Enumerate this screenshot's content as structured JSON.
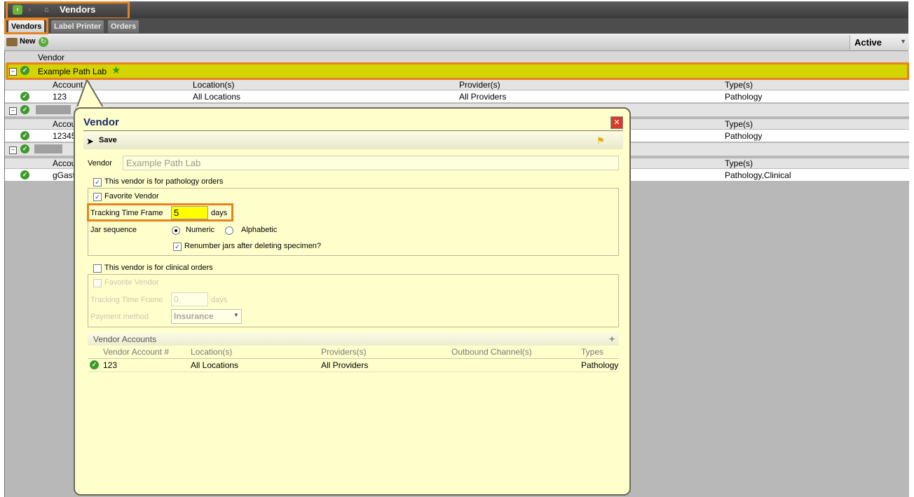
{
  "window": {
    "title": "Vendors"
  },
  "tabs": [
    {
      "label": "Vendors"
    },
    {
      "label": "Label Printer"
    },
    {
      "label": "Orders"
    }
  ],
  "toolbar": {
    "new_label": "New",
    "filter_value": "Active"
  },
  "grid": {
    "column_header": "Vendor",
    "sub_headers": {
      "account": "Account #",
      "location": "Location(s)",
      "provider": "Provider(s)",
      "types": "Type(s)"
    },
    "vendors": [
      {
        "name": "Example Path Lab",
        "account": "123",
        "location": "All Locations",
        "provider": "All Providers",
        "types": "Pathology",
        "favorite": true
      },
      {
        "name": "",
        "account": "12345",
        "types": "Pathology"
      },
      {
        "name": "",
        "account": "gGast",
        "types": "Pathology,Clinical"
      }
    ],
    "trunc_account": "Accou"
  },
  "popup": {
    "title": "Vendor",
    "save_label": "Save",
    "vendor_label": "Vendor",
    "vendor_value": "Example Path Lab",
    "pathology": {
      "checkbox_label": "This vendor is for pathology orders",
      "checked": true,
      "favorite_label": "Favorite Vendor",
      "tracking_label": "Tracking Time Frame",
      "tracking_value": "5",
      "tracking_units": "days",
      "jar_label": "Jar sequence",
      "jar_options": [
        "Numeric",
        "Alphabetic"
      ],
      "jar_selected": "Numeric",
      "renumber_label": "Renumber jars after deleting specimen?"
    },
    "clinical": {
      "checkbox_label": "This vendor is for clinical orders",
      "checked": false,
      "favorite_label": "Favorite Vendor",
      "tracking_label": "Tracking Time Frame",
      "tracking_value": "0",
      "tracking_units": "days",
      "payment_label": "Payment method",
      "payment_value": "Insurance"
    },
    "accounts": {
      "section_title": "Vendor Accounts",
      "add_symbol": "+",
      "columns": [
        "Vendor Account #",
        "Location(s)",
        "Providers(s)",
        "Outbound Channel(s)",
        "Types"
      ],
      "rows": [
        {
          "account": "123",
          "location": "All Locations",
          "provider": "All Providers",
          "channel": "",
          "types": "Pathology"
        }
      ]
    }
  },
  "colors": {
    "highlight": "#e8821e",
    "selected_row": "#d4d400",
    "popup_bg": "#ffffcc",
    "ok_green": "#3d9a2b"
  }
}
